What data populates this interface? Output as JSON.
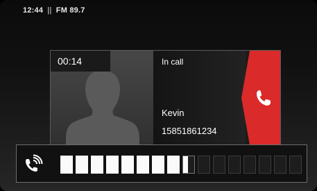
{
  "status_bar": {
    "time": "12:44",
    "separator": "||",
    "radio": "FM 89.7"
  },
  "call": {
    "duration": "00:14",
    "state": "In call",
    "contact_name": "Kevin",
    "contact_number": "15851861234",
    "hangup_icon": "phone-hangup-icon",
    "avatar_icon": "person-silhouette-icon"
  },
  "volume": {
    "icon": "phone-speaker-icon",
    "segments_total": 16,
    "level": 8.5
  },
  "colors": {
    "hangup": "#da2a2a",
    "volume_on": "#fafafa"
  }
}
